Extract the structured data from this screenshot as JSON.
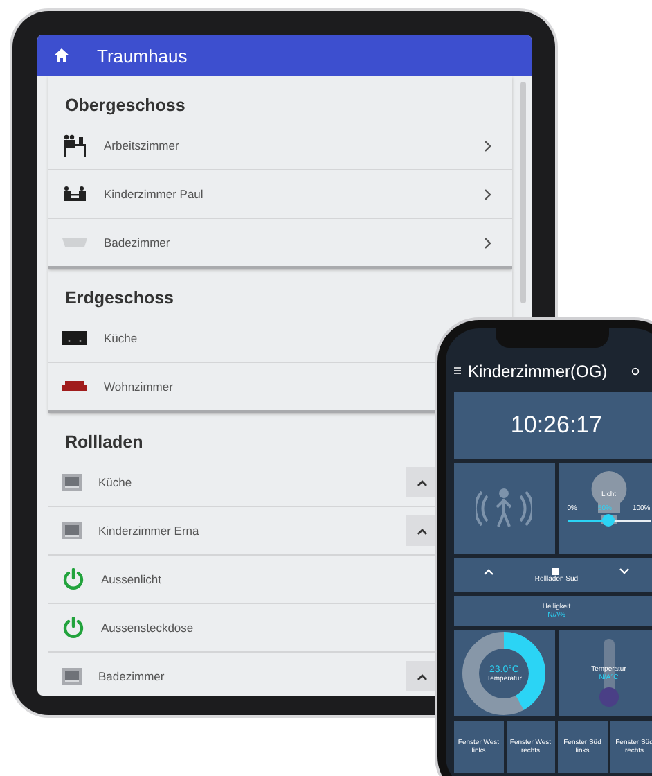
{
  "tablet": {
    "title": "Traumhaus",
    "sections": [
      {
        "heading": "Obergeschoss",
        "items": [
          {
            "label": "Arbeitszimmer",
            "kind": "desk"
          },
          {
            "label": "Kinderzimmer  Paul",
            "kind": "kids"
          },
          {
            "label": "Badezimmer",
            "kind": "bathtub"
          }
        ]
      },
      {
        "heading": "Erdgeschoss",
        "items": [
          {
            "label": "Küche",
            "kind": "stove"
          },
          {
            "label": "Wohnzimmer",
            "kind": "sofa"
          }
        ]
      },
      {
        "heading": "Rollladen",
        "items": [
          {
            "label": "Küche",
            "kind": "shutter"
          },
          {
            "label": "Kinderzimmer  Erna",
            "kind": "shutter"
          },
          {
            "label": "Aussenlicht",
            "kind": "power"
          },
          {
            "label": "Aussensteckdose",
            "kind": "power"
          },
          {
            "label": "Badezimmer",
            "kind": "shutter"
          }
        ]
      }
    ]
  },
  "phone": {
    "title": "Kinderzimmer(OG)",
    "clock": "10:26:17",
    "light": {
      "label": "Licht",
      "min": "0%",
      "mid": "50%",
      "max": "100%",
      "level": 0.5
    },
    "shutter": {
      "label": "Rollladen Süd"
    },
    "brightness": {
      "label": "Helligkeit",
      "value": "N/A%"
    },
    "gauge": {
      "value": "23.0°C",
      "label": "Temperatur",
      "level": 0.42
    },
    "thermometer": {
      "label": "Temperatur",
      "value": "N/A°C"
    },
    "buttons": [
      "Fenster West links",
      "Fenster West rechts",
      "Fenster Süd links",
      "Fenster Süd rechts"
    ]
  }
}
